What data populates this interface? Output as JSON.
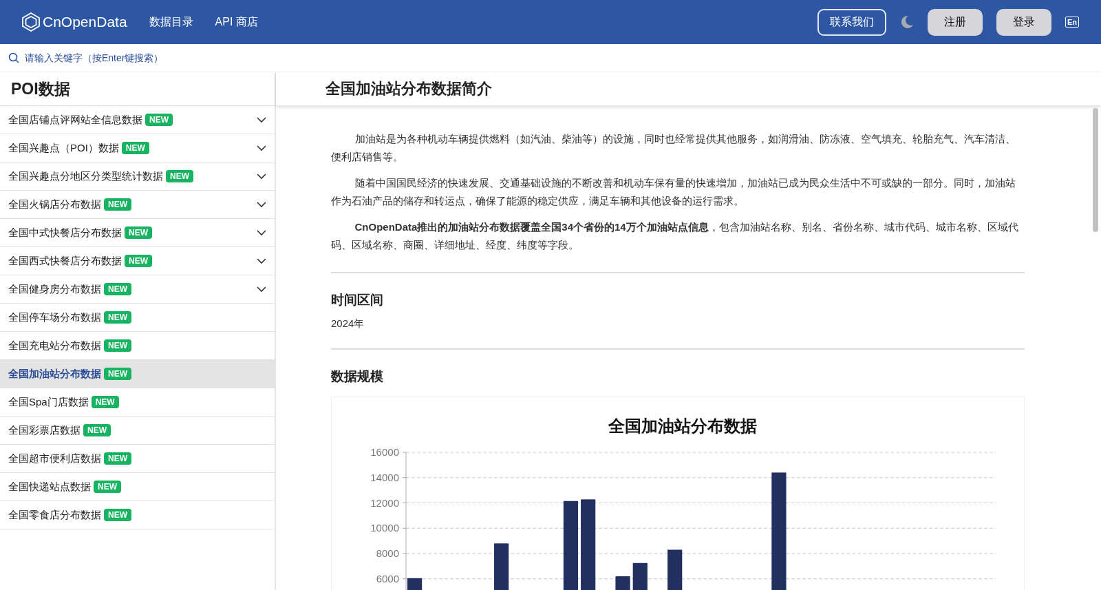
{
  "header": {
    "logo": "CnOpenData",
    "nav": [
      "数据目录",
      "API 商店"
    ],
    "contact": "联系我们",
    "register": "注册",
    "login": "登录",
    "lang": "En"
  },
  "search": {
    "placeholder": "请输入关键字（按Enter键搜索）"
  },
  "sidebar": {
    "title": "POI数据",
    "items": [
      {
        "label": "全国店铺点评网站全信息数据",
        "badge": "NEW",
        "expandable": true,
        "selected": false
      },
      {
        "label": "全国兴趣点（POI）数据",
        "badge": "NEW",
        "expandable": true,
        "selected": false
      },
      {
        "label": "全国兴趣点分地区分类型统计数据",
        "badge": "NEW",
        "expandable": true,
        "selected": false
      },
      {
        "label": "全国火锅店分布数据",
        "badge": "NEW",
        "expandable": true,
        "selected": false
      },
      {
        "label": "全国中式快餐店分布数据",
        "badge": "NEW",
        "expandable": true,
        "selected": false
      },
      {
        "label": "全国西式快餐店分布数据",
        "badge": "NEW",
        "expandable": true,
        "selected": false
      },
      {
        "label": "全国健身房分布数据",
        "badge": "NEW",
        "expandable": true,
        "selected": false
      },
      {
        "label": "全国停车场分布数据",
        "badge": "NEW",
        "expandable": false,
        "selected": false
      },
      {
        "label": "全国充电站分布数据",
        "badge": "NEW",
        "expandable": false,
        "selected": false
      },
      {
        "label": "全国加油站分布数据",
        "badge": "NEW",
        "expandable": false,
        "selected": true
      },
      {
        "label": "全国Spa门店数据",
        "badge": "NEW",
        "expandable": false,
        "selected": false
      },
      {
        "label": "全国彩票店数据",
        "badge": "NEW",
        "expandable": false,
        "selected": false
      },
      {
        "label": "全国超市便利店数据",
        "badge": "NEW",
        "expandable": false,
        "selected": false
      },
      {
        "label": "全国快递站点数据",
        "badge": "NEW",
        "expandable": false,
        "selected": false
      },
      {
        "label": "全国零食店分布数据",
        "badge": "NEW",
        "expandable": false,
        "selected": false
      }
    ]
  },
  "main": {
    "title": "全国加油站分布数据简介",
    "paragraphs": [
      "加油站是为各种机动车辆提供燃料（如汽油、柴油等）的设施，同时也经常提供其他服务，如润滑油、防冻液、空气填充、轮胎充气、汽车清洁、便利店销售等。",
      "随着中国国民经济的快速发展、交通基础设施的不断改善和机动车保有量的快速增加，加油站已成为民众生活中不可或缺的一部分。同时，加油站作为石油产品的储存和转运点，确保了能源的稳定供应，满足车辆和其他设备的运行需求。",
      "**CnOpenData推出的加油站分布数据覆盖全国34个省份的14万个加油站点信息**，包含加油站名称、别名、省份名称、城市代码、城市名称、区域代码、区域名称、商圈、详细地址、经度、纬度等字段。"
    ],
    "sections": [
      {
        "heading": "时间区间",
        "text": "2024年"
      },
      {
        "heading": "数据规模"
      }
    ],
    "chart_data": {
      "type": "bar",
      "title": "全国加油站分布数据",
      "ylim": [
        0,
        16000
      ],
      "yticks": [
        6000,
        8000,
        10000,
        12000,
        14000,
        16000
      ],
      "grid": true,
      "series": [
        {
          "color": "#21305e",
          "values": [
            6050,
            null,
            null,
            null,
            null,
            8800,
            null,
            null,
            null,
            12150,
            12280,
            null,
            6200,
            7250,
            null,
            8300,
            null,
            null,
            null,
            null,
            null,
            14400,
            null,
            null,
            null,
            null,
            null,
            null,
            null,
            null,
            null,
            null,
            null,
            null
          ]
        }
      ]
    }
  }
}
